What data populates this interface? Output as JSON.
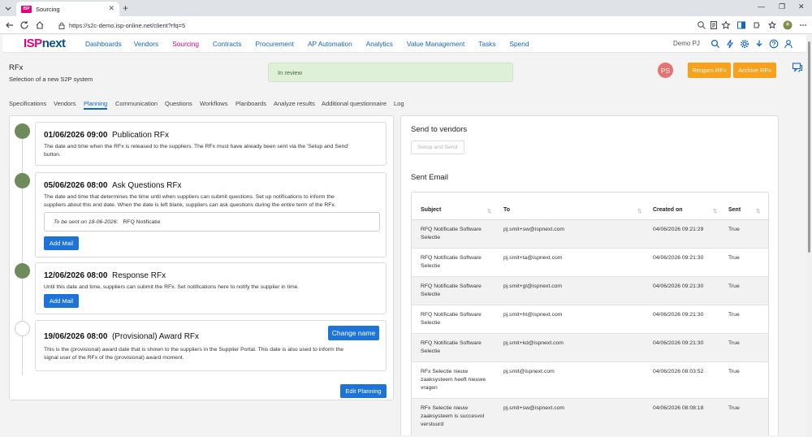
{
  "browser": {
    "tab_title": "Sourcing",
    "favicon_text": "ISP",
    "url": "https://s2c-demo.isp-online.net/client?rfq=5"
  },
  "nav": {
    "logo_isp": "ISP",
    "logo_next": "next",
    "items": [
      {
        "label": "Dashboards"
      },
      {
        "label": "Vendors"
      },
      {
        "label": "Sourcing",
        "active": true
      },
      {
        "label": "Contracts"
      },
      {
        "label": "Procurement"
      },
      {
        "label": "AP Automation"
      },
      {
        "label": "Analytics"
      },
      {
        "label": "Value Management"
      },
      {
        "label": "Tasks"
      },
      {
        "label": "Spend"
      }
    ],
    "user": "Demo PJ"
  },
  "header": {
    "title": "RFx",
    "subtitle": "Selection of a new S2P system",
    "status": "In review",
    "avatar": "PS",
    "reopen": "Reopen RFx",
    "archive": "Archive RFx"
  },
  "subtabs": [
    "Specifications",
    "Vendors",
    "Planning",
    "Communication",
    "Questions",
    "Workflows",
    "Planboards",
    "Analyze results",
    "Additional questionnaire",
    "Log"
  ],
  "planning": {
    "events": [
      {
        "date": "01/06/2026 09:00",
        "title": "Publication RFx",
        "desc1": "The date and time when the RFx is released to the suppliers. The RFx must have already been sent via the 'Setup and Send'",
        "desc2": "button."
      },
      {
        "date": "05/06/2026 08:00",
        "title": "Ask Questions RFx",
        "desc1": "The date and time that determines the time until when suppliers can submit questions. Set up notifications to inform the",
        "desc2": "suppliers about this end date. When the date is left blank, suppliers can ask questions during the entire term of the RFx.",
        "notice_label": "To be sent on 18-06-2026:",
        "notice_value": "RFQ Notificatie",
        "button": "Add Mail"
      },
      {
        "date": "12/06/2026 08:00",
        "title": "Response RFx",
        "desc1": "Until this date and time, suppliers can submit the RFx. Set notifications here to notify the supplier in time.",
        "button": "Add Mail"
      },
      {
        "date": "19/06/2026 08:00",
        "title": "(Provisional) Award RFx",
        "desc1": "This is the (provisional) award date that is shown to the suppliers in the Supplier Portal. This date is also used to inform the",
        "desc2": "signal user of the RFx of the (provisional) award moment.",
        "button": "Change name"
      }
    ],
    "edit_button": "Edit Planning"
  },
  "send": {
    "title": "Send to vendors",
    "setup_button": "Setup and Send",
    "sent_title": "Sent Email",
    "columns": [
      "Subject",
      "To",
      "Created on",
      "Sent"
    ],
    "rows": [
      {
        "subject": [
          "RFQ Notificatie Software",
          "Selectie"
        ],
        "to": "pj.smit+sw@ispnext.com",
        "created": "04/06/2026 09:21:29",
        "sent": "True"
      },
      {
        "subject": [
          "RFQ Notificatie Software",
          "Selectie"
        ],
        "to": "pj.smit+ta@ispnext.com",
        "created": "04/06/2026 09:21:30",
        "sent": "True"
      },
      {
        "subject": [
          "RFQ Notificatie Software",
          "Selectie"
        ],
        "to": "pj.smit+gl@ispnext.com",
        "created": "04/06/2026 09:21:30",
        "sent": "True"
      },
      {
        "subject": [
          "RFQ Notificatie Software",
          "Selectie"
        ],
        "to": "pj.smit+ht@ispnext.com",
        "created": "04/06/2026 09:21:30",
        "sent": "True"
      },
      {
        "subject": [
          "RFQ Notificatie Software",
          "Selectie"
        ],
        "to": "pj.smit+kd@ispnext.com",
        "created": "04/06/2026 09:21:30",
        "sent": "True"
      },
      {
        "subject": [
          "RFx Selectie nieuw",
          "zaaksysteem heeft nieuwe",
          "vragen"
        ],
        "to": "pj.smit@ispnext.com",
        "created": "04/06/2026 08:03:52",
        "sent": "True"
      },
      {
        "subject": [
          "RFx Selectie nieuw",
          "zaaksysteem is succesvol",
          "verstuurd"
        ],
        "to": "pj.smit+sw@ispnext.com",
        "created": "04/06/2026 08:08:18",
        "sent": "True"
      }
    ]
  },
  "colors": {
    "brand_pink": "#e6007e",
    "brand_navy": "#0b4f8a",
    "link_blue": "#1565c0",
    "button_blue": "#1e74d6",
    "button_orange": "#f9a11b",
    "timeline_green": "#6e8b5c",
    "status_green_bg": "#dff0d8"
  }
}
